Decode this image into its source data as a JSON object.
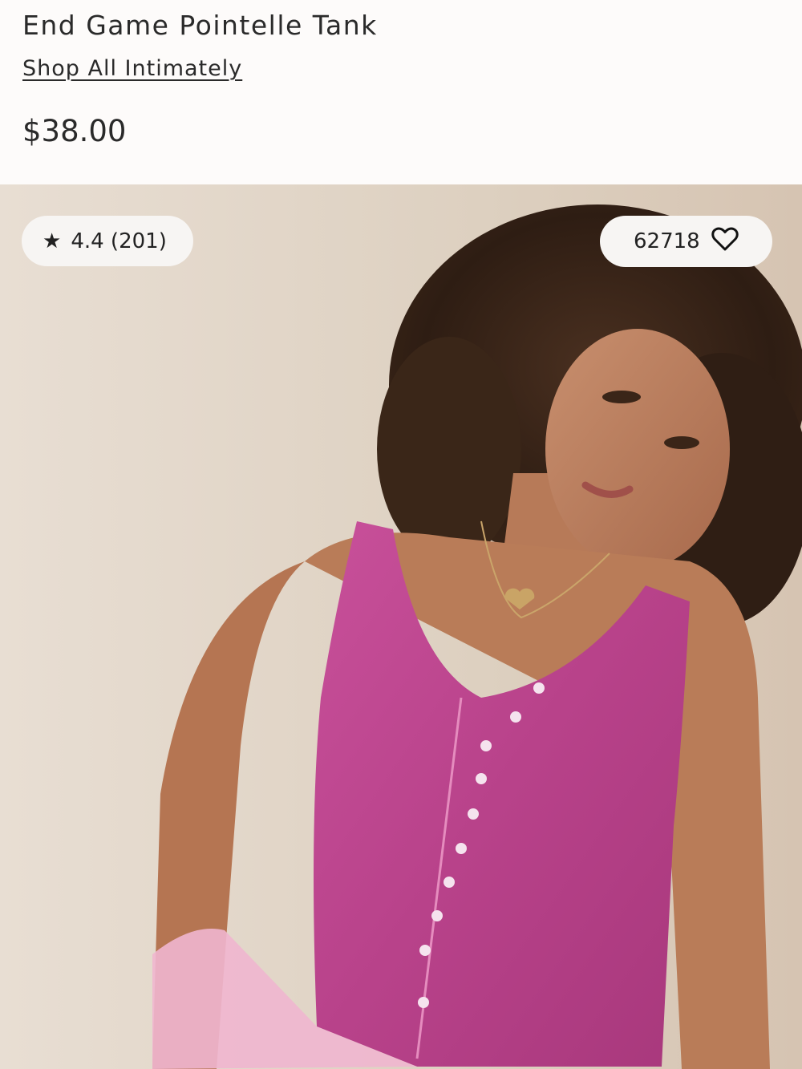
{
  "product": {
    "title": "End Game Pointelle Tank",
    "shop_link": "Shop All Intimately",
    "price": "$38.00"
  },
  "badges": {
    "rating_star": "★",
    "rating_text": "4.4 (201)",
    "favorites_count": "62718",
    "favorites_icon": "heart-outline-icon"
  },
  "colors": {
    "page_bg": "#fdfbfa",
    "tank_pink": "#c04a8c",
    "backdrop": "#e0d3c4"
  }
}
